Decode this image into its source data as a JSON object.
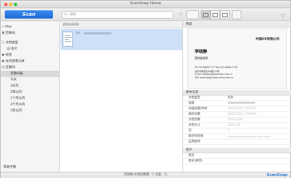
{
  "window": {
    "title": "ScanSnap Home"
  },
  "toolbar": {
    "scan_label": "Scan",
    "search_placeholder": "Q~ 搜索"
  },
  "sidebar": {
    "items": [
      {
        "icon": "computer-icon",
        "label": "Mac"
      },
      {
        "icon": "trash-icon",
        "label": "回收站"
      },
      {
        "icon": "doc-icon",
        "label": "文档类型"
      },
      {
        "icon": "card-icon",
        "label": "名片"
      },
      {
        "icon": "tag-icon",
        "label": "标签"
      },
      {
        "icon": "history-icon",
        "label": "访问查看记录"
      },
      {
        "icon": "clock-icon",
        "label": "在期间"
      },
      {
        "icon": "",
        "label": "近期扫描"
      },
      {
        "icon": "",
        "label": "今天"
      },
      {
        "icon": "",
        "label": "3天内"
      },
      {
        "icon": "",
        "label": "1周以内"
      },
      {
        "icon": "",
        "label": "1个月以内"
      },
      {
        "icon": "",
        "label": "3个月以内"
      },
      {
        "icon": "",
        "label": "1年以内"
      }
    ],
    "footer_label": "帮助手册"
  },
  "list": {
    "header_date": "2021/3/20",
    "item_tag": "名片"
  },
  "preview": {
    "section_label": "预览",
    "company": "中国XX有限公司",
    "name": "李晓静",
    "title": "营销部经理",
    "lines": [
      "Tel 010-6666-7777  Fax 010-6666-7778",
      "北京市海淀区XX路123号",
      "E-mail lixiaojing@example.com.cn",
      "URL www.fanghuidao.china.com.cn"
    ]
  },
  "props": {
    "section_label": "基本信息",
    "rows": [
      {
        "k": "文档类型",
        "v": "名片"
      },
      {
        "k": "标题",
        "v": ""
      },
      {
        "k": "扫描日期/时间",
        "v": "2021/3/20 上午9:41"
      },
      {
        "k": "修改日期",
        "v": "2021/3/20 上午9:41"
      },
      {
        "k": "文档页数",
        "v": "2021/3/20"
      },
      {
        "k": "文档大小",
        "v": "2021 KB"
      },
      {
        "k": "页",
        "v": "1"
      },
      {
        "k": "保存目的地",
        "v": "/Users/user/Library/ScanSnap Home/..."
      },
      {
        "k": "应用程序",
        "v": ""
      }
    ]
  },
  "props2": {
    "section_label": "名片",
    "rows": [
      {
        "k": "姓名",
        "v": ""
      },
      {
        "k": "姓名(拼音)",
        "v": ""
      }
    ]
  },
  "status": {
    "message": "内容数(文档总数量：1 页面：1)",
    "brand": "ScanSnap"
  }
}
